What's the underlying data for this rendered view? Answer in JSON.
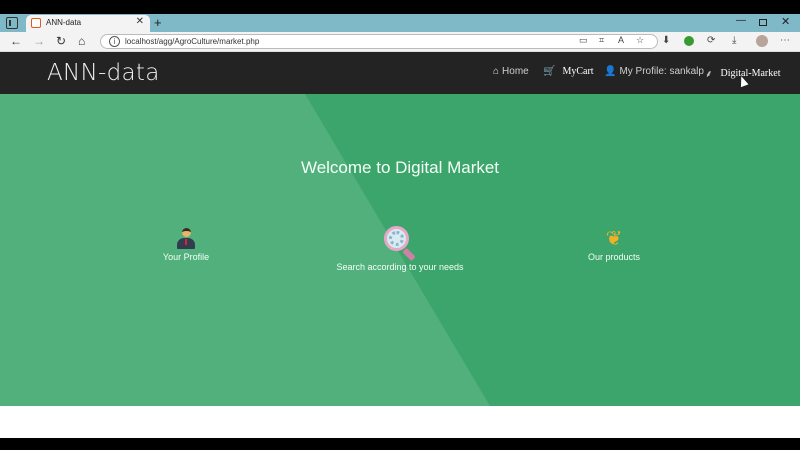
{
  "browser": {
    "tab_title": "ANN-data",
    "tab_close": "✕",
    "new_tab": "+",
    "url": "localhost/agg/AgroCulture/market.php",
    "window": {
      "minimize": "—",
      "close": "✕"
    },
    "nav": {
      "back": "←",
      "forward": "→",
      "reload": "↻",
      "home": "⌂"
    },
    "toolbar_icons": [
      "tab-search-icon",
      "qr-code-icon",
      "read-aloud-icon",
      "favorites-icon",
      "extension-icon",
      "browser-essentials-icon",
      "downloads-icon",
      "profile-avatar-icon",
      "more-icon"
    ]
  },
  "navbar": {
    "brand": "ANN-data",
    "links": {
      "home": "Home",
      "mycart": "MyCart",
      "profile": "My Profile: sankalp",
      "market": "Digital-Market"
    }
  },
  "hero": {
    "title": "Welcome to Digital Market",
    "features": {
      "profile": "Your Profile",
      "search": "Search according to your needs",
      "products": "Our products"
    }
  },
  "colors": {
    "navbar_bg": "#232323",
    "hero_bg": "#3ca56b",
    "hero_shade": "#52b07c",
    "tabstrip": "#7fb8c6"
  }
}
